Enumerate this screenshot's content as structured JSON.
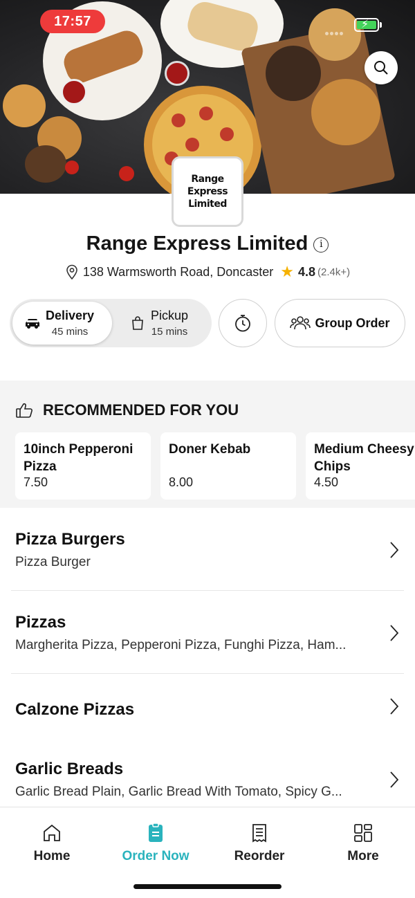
{
  "status_bar": {
    "time": "17:57"
  },
  "restaurant": {
    "logo_text": "Range Express Limited",
    "name": "Range Express Limited",
    "address": "138 Warmsworth Road, Doncaster",
    "rating": "4.8",
    "rating_count": "(2.4k+)"
  },
  "order_modes": {
    "delivery": {
      "label": "Delivery",
      "time": "45 mins"
    },
    "pickup": {
      "label": "Pickup",
      "time": "15 mins"
    },
    "group_order_label": "Group Order"
  },
  "recommended": {
    "heading": "RECOMMENDED FOR YOU",
    "items": [
      {
        "name_line1": "10inch Pepperoni",
        "name_line2": "Pizza",
        "price": "7.50"
      },
      {
        "name_line1": "Doner Kebab",
        "name_line2": "",
        "price": "8.00"
      },
      {
        "name_line1": "Medium Cheesy",
        "name_line2": "Chips",
        "price": "4.50"
      }
    ]
  },
  "categories": [
    {
      "name": "Pizza Burgers",
      "desc": "Pizza Burger"
    },
    {
      "name": "Pizzas",
      "desc": "Margherita Pizza, Pepperoni Pizza, Funghi Pizza, Ham..."
    },
    {
      "name": "Calzone Pizzas",
      "desc": ""
    },
    {
      "name": "Garlic Breads",
      "desc": "Garlic Bread Plain, Garlic Bread With Tomato, Spicy G..."
    }
  ],
  "bottom_nav": [
    {
      "label": "Home",
      "icon": "home-icon"
    },
    {
      "label": "Order Now",
      "icon": "order-icon"
    },
    {
      "label": "Reorder",
      "icon": "receipt-icon"
    },
    {
      "label": "More",
      "icon": "grid-icon"
    }
  ],
  "colors": {
    "accent": "#2ab3bd",
    "time_pill": "#ee3b3b",
    "star": "#f5b100",
    "battery": "#43d35a"
  }
}
